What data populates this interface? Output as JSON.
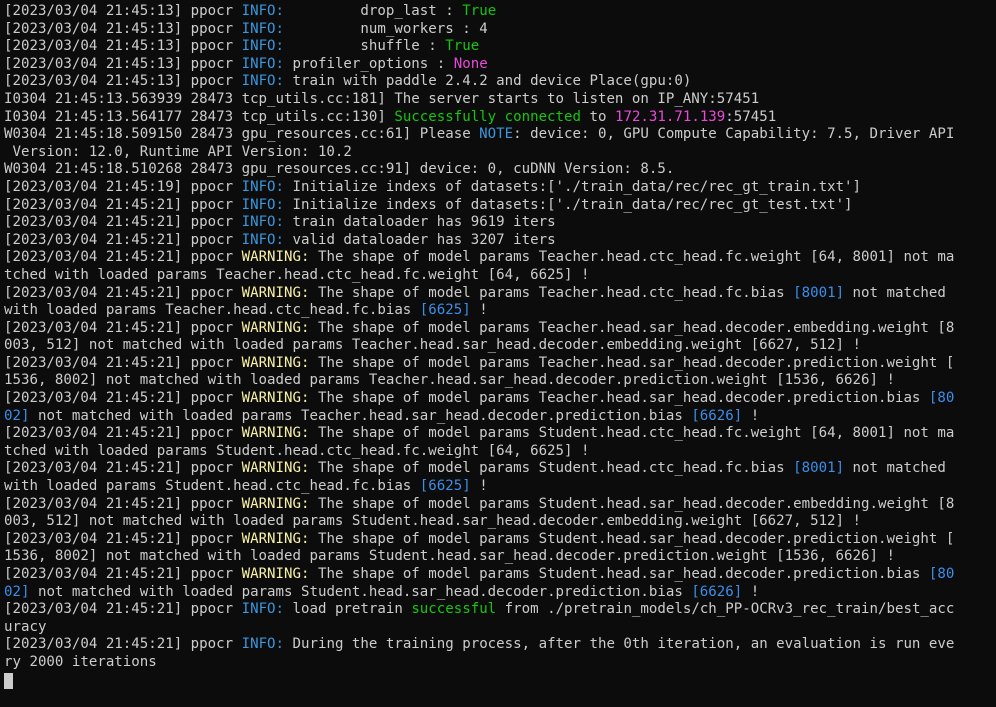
{
  "terminal": {
    "lines": [
      [
        {
          "t": "[2023/03/04 21:45:13] ppocr "
        },
        {
          "t": "INFO:",
          "c": "info"
        },
        {
          "t": "         drop_last : "
        },
        {
          "t": "True",
          "c": "green"
        }
      ],
      [
        {
          "t": "[2023/03/04 21:45:13] ppocr "
        },
        {
          "t": "INFO:",
          "c": "info"
        },
        {
          "t": "         num_workers : 4"
        }
      ],
      [
        {
          "t": "[2023/03/04 21:45:13] ppocr "
        },
        {
          "t": "INFO:",
          "c": "info"
        },
        {
          "t": "         shuffle : "
        },
        {
          "t": "True",
          "c": "green"
        }
      ],
      [
        {
          "t": "[2023/03/04 21:45:13] ppocr "
        },
        {
          "t": "INFO:",
          "c": "info"
        },
        {
          "t": " profiler_options : "
        },
        {
          "t": "None",
          "c": "magenta"
        }
      ],
      [
        {
          "t": "[2023/03/04 21:45:13] ppocr "
        },
        {
          "t": "INFO:",
          "c": "info"
        },
        {
          "t": " train with paddle 2.4.2 and device Place(gpu:0)"
        }
      ],
      [
        {
          "t": "I0304 21:45:13.563939 28473 tcp_utils.cc:181] The server starts to listen on IP_ANY:57451"
        }
      ],
      [
        {
          "t": "I0304 21:45:13.564177 28473 tcp_utils.cc:130] "
        },
        {
          "t": "Successfully connected",
          "c": "green"
        },
        {
          "t": " to "
        },
        {
          "t": "172.31.71.139",
          "c": "magenta"
        },
        {
          "t": ":57451"
        }
      ],
      [
        {
          "t": "W0304 21:45:18.509150 28473 gpu_resources.cc:61] Please "
        },
        {
          "t": "NOTE",
          "c": "note"
        },
        {
          "t": ": device: 0, GPU Compute Capability: 7.5, Driver API"
        }
      ],
      [
        {
          "t": " Version: 12.0, Runtime API Version: 10.2"
        }
      ],
      [
        {
          "t": "W0304 21:45:18.510268 28473 gpu_resources.cc:91] device: 0, cuDNN Version: 8.5."
        }
      ],
      [
        {
          "t": "[2023/03/04 21:45:19] ppocr "
        },
        {
          "t": "INFO:",
          "c": "info"
        },
        {
          "t": " Initialize indexs of datasets:['./train_data/rec/rec_gt_train.txt']"
        }
      ],
      [
        {
          "t": "[2023/03/04 21:45:21] ppocr "
        },
        {
          "t": "INFO:",
          "c": "info"
        },
        {
          "t": " Initialize indexs of datasets:['./train_data/rec/rec_gt_test.txt']"
        }
      ],
      [
        {
          "t": "[2023/03/04 21:45:21] ppocr "
        },
        {
          "t": "INFO:",
          "c": "info"
        },
        {
          "t": " train dataloader has 9619 iters"
        }
      ],
      [
        {
          "t": "[2023/03/04 21:45:21] ppocr "
        },
        {
          "t": "INFO:",
          "c": "info"
        },
        {
          "t": " valid dataloader has 3207 iters"
        }
      ],
      [
        {
          "t": "[2023/03/04 21:45:21] ppocr "
        },
        {
          "t": "WARNING:",
          "c": "warn"
        },
        {
          "t": " The shape of model params Teacher.head.ctc_head.fc.weight [64, 8001] not ma"
        }
      ],
      [
        {
          "t": "tched with loaded params Teacher.head.ctc_head.fc.weight [64, 6625] !"
        }
      ],
      [
        {
          "t": "[2023/03/04 21:45:21] ppocr "
        },
        {
          "t": "WARNING:",
          "c": "warn"
        },
        {
          "t": " The shape of model params Teacher.head.ctc_head.fc.bias "
        },
        {
          "t": "[8001]",
          "c": "blue"
        },
        {
          "t": " not matched"
        }
      ],
      [
        {
          "t": "with loaded params Teacher.head.ctc_head.fc.bias "
        },
        {
          "t": "[6625]",
          "c": "blue"
        },
        {
          "t": " !"
        }
      ],
      [
        {
          "t": "[2023/03/04 21:45:21] ppocr "
        },
        {
          "t": "WARNING:",
          "c": "warn"
        },
        {
          "t": " The shape of model params Teacher.head.sar_head.decoder.embedding.weight [8"
        }
      ],
      [
        {
          "t": "003, 512] not matched with loaded params Teacher.head.sar_head.decoder.embedding.weight [6627, 512] !"
        }
      ],
      [
        {
          "t": "[2023/03/04 21:45:21] ppocr "
        },
        {
          "t": "WARNING:",
          "c": "warn"
        },
        {
          "t": " The shape of model params Teacher.head.sar_head.decoder.prediction.weight ["
        }
      ],
      [
        {
          "t": "1536, 8002] not matched with loaded params Teacher.head.sar_head.decoder.prediction.weight [1536, 6626] !"
        }
      ],
      [
        {
          "t": "[2023/03/04 21:45:21] ppocr "
        },
        {
          "t": "WARNING:",
          "c": "warn"
        },
        {
          "t": " The shape of model params Teacher.head.sar_head.decoder.prediction.bias "
        },
        {
          "t": "[80",
          "c": "blue"
        }
      ],
      [
        {
          "t": "02]",
          "c": "blue"
        },
        {
          "t": " not matched with loaded params Teacher.head.sar_head.decoder.prediction.bias "
        },
        {
          "t": "[6626]",
          "c": "blue"
        },
        {
          "t": " !"
        }
      ],
      [
        {
          "t": "[2023/03/04 21:45:21] ppocr "
        },
        {
          "t": "WARNING:",
          "c": "warn"
        },
        {
          "t": " The shape of model params Student.head.ctc_head.fc.weight [64, 8001] not ma"
        }
      ],
      [
        {
          "t": "tched with loaded params Student.head.ctc_head.fc.weight [64, 6625] !"
        }
      ],
      [
        {
          "t": "[2023/03/04 21:45:21] ppocr "
        },
        {
          "t": "WARNING:",
          "c": "warn"
        },
        {
          "t": " The shape of model params Student.head.ctc_head.fc.bias "
        },
        {
          "t": "[8001]",
          "c": "blue"
        },
        {
          "t": " not matched"
        }
      ],
      [
        {
          "t": "with loaded params Student.head.ctc_head.fc.bias "
        },
        {
          "t": "[6625]",
          "c": "blue"
        },
        {
          "t": " !"
        }
      ],
      [
        {
          "t": "[2023/03/04 21:45:21] ppocr "
        },
        {
          "t": "WARNING:",
          "c": "warn"
        },
        {
          "t": " The shape of model params Student.head.sar_head.decoder.embedding.weight [8"
        }
      ],
      [
        {
          "t": "003, 512] not matched with loaded params Student.head.sar_head.decoder.embedding.weight [6627, 512] !"
        }
      ],
      [
        {
          "t": "[2023/03/04 21:45:21] ppocr "
        },
        {
          "t": "WARNING:",
          "c": "warn"
        },
        {
          "t": " The shape of model params Student.head.sar_head.decoder.prediction.weight ["
        }
      ],
      [
        {
          "t": "1536, 8002] not matched with loaded params Student.head.sar_head.decoder.prediction.weight [1536, 6626] !"
        }
      ],
      [
        {
          "t": "[2023/03/04 21:45:21] ppocr "
        },
        {
          "t": "WARNING:",
          "c": "warn"
        },
        {
          "t": " The shape of model params Student.head.sar_head.decoder.prediction.bias "
        },
        {
          "t": "[80",
          "c": "blue"
        }
      ],
      [
        {
          "t": "02]",
          "c": "blue"
        },
        {
          "t": " not matched with loaded params Student.head.sar_head.decoder.prediction.bias "
        },
        {
          "t": "[6626]",
          "c": "blue"
        },
        {
          "t": " !"
        }
      ],
      [
        {
          "t": "[2023/03/04 21:45:21] ppocr "
        },
        {
          "t": "INFO:",
          "c": "info"
        },
        {
          "t": " load pretrain "
        },
        {
          "t": "successful",
          "c": "green"
        },
        {
          "t": " from ./pretrain_models/ch_PP-OCRv3_rec_train/best_acc"
        }
      ],
      [
        {
          "t": "uracy"
        }
      ],
      [
        {
          "t": "[2023/03/04 21:45:21] ppocr "
        },
        {
          "t": "INFO:",
          "c": "info"
        },
        {
          "t": " During the training process, after the 0th iteration, an evaluation is run eve"
        }
      ],
      [
        {
          "t": "ry 2000 iterations"
        }
      ]
    ]
  }
}
